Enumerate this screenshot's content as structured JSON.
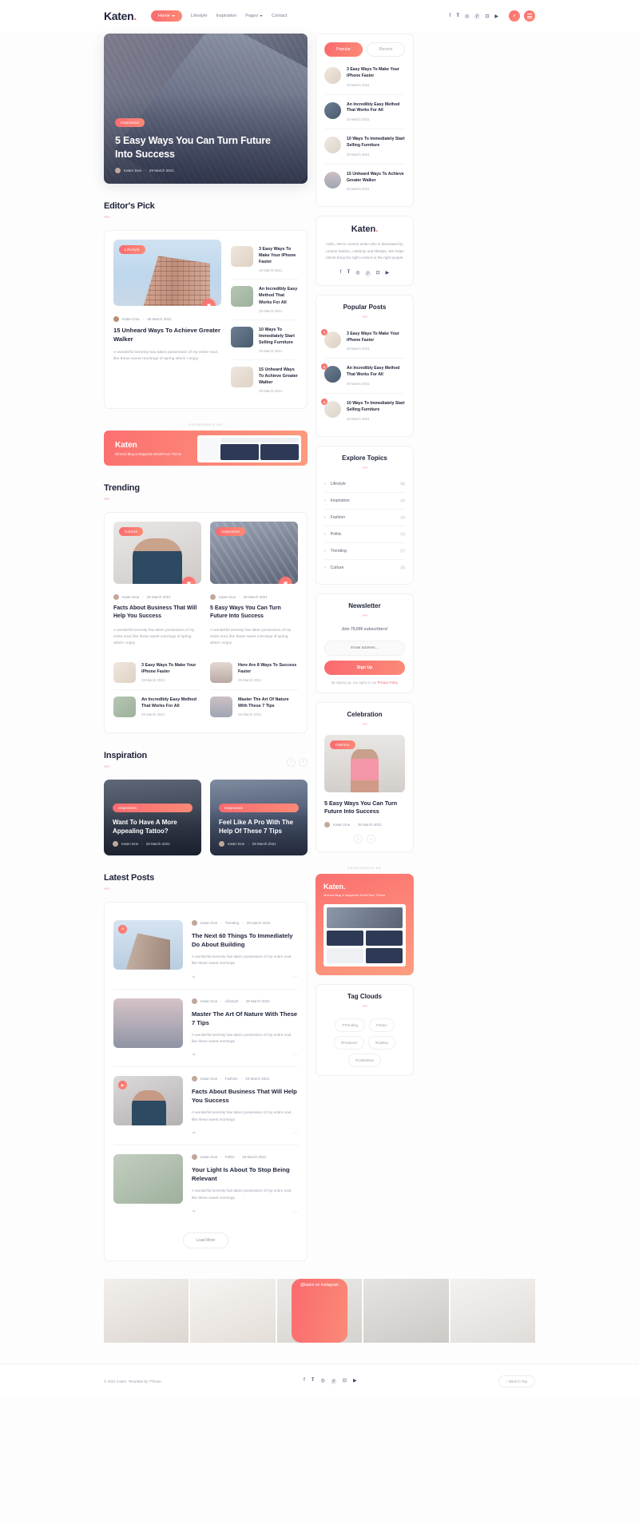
{
  "site": {
    "name": "Katen",
    "dot": "."
  },
  "nav": {
    "items": [
      {
        "label": "Home",
        "active": true,
        "caret": true
      },
      {
        "label": "Lifestyle",
        "active": false,
        "caret": false
      },
      {
        "label": "Inspiration",
        "active": false,
        "caret": false
      },
      {
        "label": "Pages",
        "active": false,
        "caret": true
      },
      {
        "label": "Contact",
        "active": false,
        "caret": false
      }
    ],
    "socials": [
      "f",
      "𝐓",
      "◎",
      "Ⓟ",
      "⊡",
      "▶"
    ],
    "search_icon": "🔍",
    "menu_icon": "menu"
  },
  "hero": {
    "tag": "Inspiration",
    "title": "5 Easy Ways You Can Turn Future Into Success",
    "author": "Katen Doe",
    "date": "29 March 2021"
  },
  "sidebar_tabs": {
    "popular": "Popular",
    "recent": "Recent"
  },
  "tab_posts": [
    {
      "title": "3 Easy Ways To Make Your iPhone Faster",
      "date": "29 March 2021",
      "thumb": "th-phone"
    },
    {
      "title": "An Incredibly Easy Method That Works For All",
      "date": "29 March 2021",
      "thumb": "th-person"
    },
    {
      "title": "10 Ways To Immediately Start Selling Furniture",
      "date": "29 March 2021",
      "thumb": "th-ladder"
    },
    {
      "title": "15 Unheard Ways To Achieve Greater Walker",
      "date": "29 March 2021",
      "thumb": "th-sea"
    }
  ],
  "editors_pick": {
    "heading": "Editor's Pick",
    "feature": {
      "tag": "Lifestyle",
      "author": "Katen Doe",
      "date": "29 March 2021",
      "title": "15 Unheard Ways To Achieve Greater Walker",
      "excerpt": "A wonderful serenity has taken possession of my entire soul, like these sweet mornings of spring which I enjoy"
    },
    "list": [
      {
        "title": "3 Easy Ways To Make Your iPhone Faster",
        "date": "29 March 2021",
        "thumb": "th-phone"
      },
      {
        "title": "An Incredibly Easy Method That Works For All",
        "date": "29 March 2021",
        "thumb": "th-lamp"
      },
      {
        "title": "10 Ways To Immediately Start Selling Furniture",
        "date": "29 March 2021",
        "thumb": "th-person"
      },
      {
        "title": "15 Unheard Ways To Achieve Greater Walker",
        "date": "29 March 2021",
        "thumb": "th-chair"
      }
    ]
  },
  "ad": {
    "label": "SPONSORED AD",
    "logo": "Katen",
    "sub": "Minimal Blog & Magazine WordPress Theme"
  },
  "trending": {
    "heading": "Trending",
    "cards": [
      {
        "tag": "Culture",
        "author": "Katen Doe",
        "date": "29 March 2021",
        "title": "Facts About Business That Will Help You Success",
        "excerpt": "A wonderful serenity has taken possession of my entire soul, like these sweet mornings of spring which I enjoy",
        "img": "a"
      },
      {
        "tag": "Inspiration",
        "author": "Katen Doe",
        "date": "29 March 2021",
        "title": "5 Easy Ways You Can Turn Future Into Success",
        "excerpt": "A wonderful serenity has taken possession of my entire soul, like these sweet mornings of spring which I enjoy",
        "img": "b"
      }
    ],
    "mini_left": [
      {
        "title": "3 Easy Ways To Make Your iPhone Faster",
        "date": "29 March 2021",
        "thumb": "th-phone"
      },
      {
        "title": "An Incredibly Easy Method That Works For All",
        "date": "29 March 2021",
        "thumb": "th-lamp"
      }
    ],
    "mini_right": [
      {
        "title": "Here Are 8 Ways To Success Faster",
        "date": "29 March 2021",
        "thumb": "th-beach"
      },
      {
        "title": "Master The Art Of Nature With These 7 Tips",
        "date": "29 March 2021",
        "thumb": "th-sea"
      }
    ]
  },
  "inspiration": {
    "heading": "Inspiration",
    "cards": [
      {
        "tag": "Inspiration",
        "title": "Want To Have A More Appealing Tattoo?",
        "author": "Katen Doe",
        "date": "29 March 2021",
        "variant": "a"
      },
      {
        "tag": "Inspiration",
        "title": "Feel Like A Pro With The Help Of These 7 Tips",
        "author": "Katen Doe",
        "date": "29 March 2021",
        "variant": "b"
      }
    ]
  },
  "latest": {
    "heading": "Latest Posts",
    "load_more": "Load More",
    "posts": [
      {
        "author": "Katen Doe",
        "category": "Trending",
        "date": "29 March 2021",
        "title": "The Next 60 Things To Immediately Do About Building",
        "excerpt": "A wonderful serenity has taken possession of my entire soul, like these sweet mornings",
        "img": "img-sky",
        "badge": "☰"
      },
      {
        "author": "Katen Doe",
        "category": "Lifestyle",
        "date": "29 March 2021",
        "title": "Master The Art Of Nature With These 7 Tips",
        "excerpt": "A wonderful serenity has taken possession of my entire soul, like these sweet mornings",
        "img": "img-sea2",
        "badge": ""
      },
      {
        "author": "Katen Doe",
        "category": "Fashion",
        "date": "29 March 2021",
        "title": "Facts About Business That Will Help You Success",
        "excerpt": "A wonderful serenity has taken possession of my entire soul, like these sweet mornings",
        "img": "img-girl",
        "badge": "▶"
      },
      {
        "author": "Katen Doe",
        "category": "Politic",
        "date": "29 March 2021",
        "title": "Your Light Is About To Stop Being Relevant",
        "excerpt": "A wonderful serenity has taken possession of my entire soul, like these sweet mornings",
        "img": "img-lamp2",
        "badge": ""
      }
    ]
  },
  "about": {
    "logo": "Katen",
    "text": "Hello, We're content writer who is fascinated by content fashion, celebrity and lifestyle. We helps clients bring the right content to the right people.",
    "socials": [
      "f",
      "𝐓",
      "◎",
      "Ⓟ",
      "⊡",
      "▶"
    ]
  },
  "popular_posts": {
    "title": "Popular Posts",
    "items": [
      {
        "num": "1",
        "title": "3 Easy Ways To Make Your iPhone Faster",
        "date": "29 March 2021",
        "thumb": "th-phone"
      },
      {
        "num": "2",
        "title": "An Incredibly Easy Method That Works For All",
        "date": "29 March 2021",
        "thumb": "th-person"
      },
      {
        "num": "3",
        "title": "10 Ways To Immediately Start Selling Furniture",
        "date": "29 March 2021",
        "thumb": "th-ladder"
      }
    ]
  },
  "explore": {
    "title": "Explore Topics",
    "topics": [
      {
        "label": "Lifestyle",
        "count": "(5)"
      },
      {
        "label": "Inspiration",
        "count": "(2)"
      },
      {
        "label": "Fashion",
        "count": "(4)"
      },
      {
        "label": "Politic",
        "count": "(1)"
      },
      {
        "label": "Trending",
        "count": "(7)"
      },
      {
        "label": "Culture",
        "count": "(3)"
      }
    ]
  },
  "newsletter": {
    "title": "Newsletter",
    "subtitle": "Join 70,000 subscribers!",
    "placeholder": "Email address...",
    "button": "Sign Up",
    "note_pre": "By signing up, you agree to our ",
    "note_link": "Privacy Policy"
  },
  "celebration": {
    "title": "Celebration",
    "tag": "Fashion",
    "post_title": "5 Easy Ways You Can Turn Future Into Success",
    "author": "Katen Doe",
    "date": "29 March 2021"
  },
  "ad2": {
    "label": "SPONSORED AD",
    "logo": "Katen",
    "sub": "Minimal Blog & Magazine WordPress Theme"
  },
  "tagclouds": {
    "title": "Tag Clouds",
    "tags": [
      "#Trending",
      "#Video",
      "#Featured",
      "#Gallery",
      "#Celebrities"
    ]
  },
  "instagram": {
    "button": "@katen on Instagram"
  },
  "footer": {
    "copyright": "© 2021 Katen. Template by TTouse.",
    "socials": [
      "f",
      "𝐓",
      "◎",
      "Ⓟ",
      "⊡",
      "▶"
    ],
    "back_to_top": "↑  Back to Top"
  },
  "colors": {
    "accent": "#f8626f",
    "accent2": "#fb8a76",
    "dark": "#20243a",
    "muted": "#9ba0ad"
  }
}
